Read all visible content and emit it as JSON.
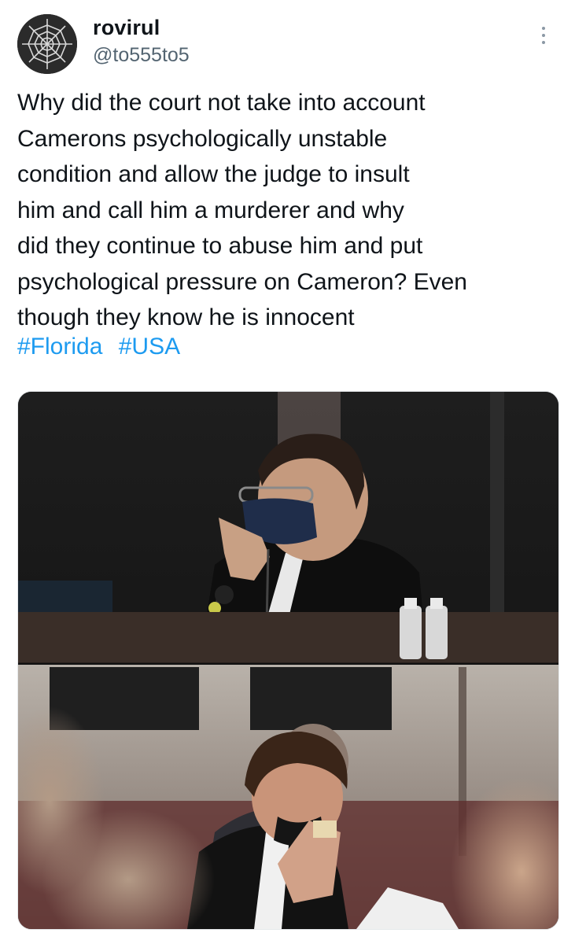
{
  "tweet": {
    "author": {
      "name": "rovirul",
      "handle": "@to555to5",
      "avatar_icon": "spider-web-icon"
    },
    "more_icon": "more-options-icon",
    "text_lines": [
      "Why did the court not take into account",
      "Camerons psychologically unstable",
      "condition and allow the judge to insult",
      "him and call him a murderer and why",
      "did they continue to abuse him and put",
      "psychological pressure on Cameron? Even",
      "though they know he is innocent"
    ],
    "hashtags": [
      "#Florida",
      "#USA"
    ],
    "media": {
      "panels": [
        "photo-man-in-mask-pointing",
        "photo-young-man-covering-face"
      ]
    }
  },
  "colors": {
    "text": "#0f1419",
    "secondary": "#536471",
    "link": "#1d9bf0"
  }
}
